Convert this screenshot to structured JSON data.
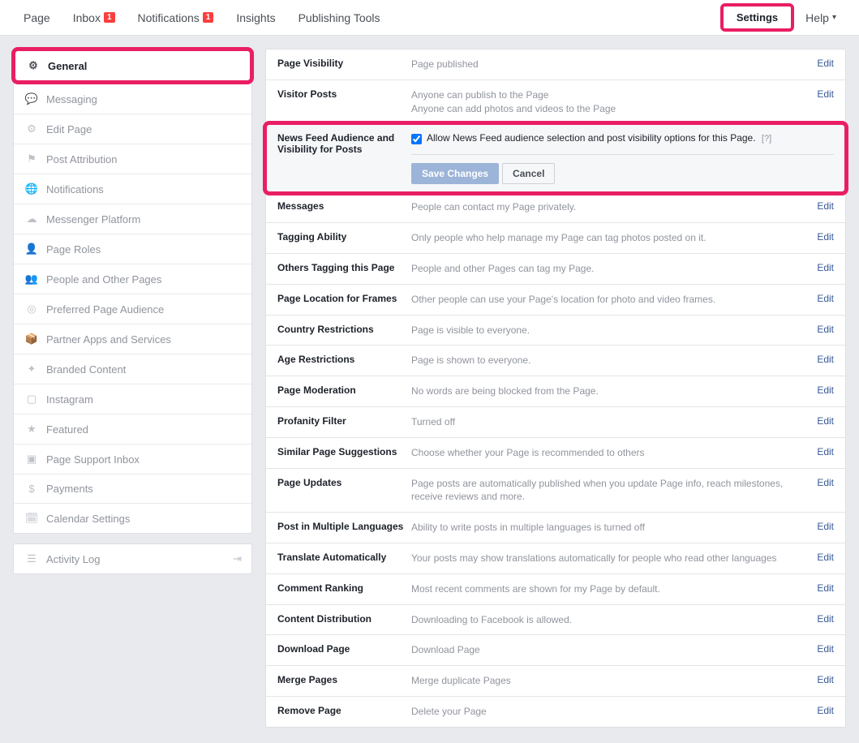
{
  "topnav": {
    "items": [
      {
        "label": "Page",
        "badge": ""
      },
      {
        "label": "Inbox",
        "badge": "1"
      },
      {
        "label": "Notifications",
        "badge": "1"
      },
      {
        "label": "Insights",
        "badge": ""
      },
      {
        "label": "Publishing Tools",
        "badge": ""
      }
    ],
    "settings_label": "Settings",
    "help_label": "Help"
  },
  "sidebar": {
    "items": [
      {
        "icon": "⚙",
        "label": "General",
        "active": true
      },
      {
        "icon": "💬",
        "label": "Messaging"
      },
      {
        "icon": "⚙",
        "label": "Edit Page"
      },
      {
        "icon": "⚑",
        "label": "Post Attribution"
      },
      {
        "icon": "🌐",
        "label": "Notifications"
      },
      {
        "icon": "☁",
        "label": "Messenger Platform"
      },
      {
        "icon": "👤",
        "label": "Page Roles"
      },
      {
        "icon": "👥",
        "label": "People and Other Pages"
      },
      {
        "icon": "◎",
        "label": "Preferred Page Audience"
      },
      {
        "icon": "📦",
        "label": "Partner Apps and Services"
      },
      {
        "icon": "✦",
        "label": "Branded Content"
      },
      {
        "icon": "▢",
        "label": "Instagram"
      },
      {
        "icon": "★",
        "label": "Featured"
      },
      {
        "icon": "▣",
        "label": "Page Support Inbox"
      },
      {
        "icon": "$",
        "label": "Payments"
      },
      {
        "icon": "🗓",
        "label": "Calendar Settings"
      }
    ],
    "activity_log": "Activity Log"
  },
  "settings": [
    {
      "label": "Page Visibility",
      "value": "Page published",
      "edit": "Edit"
    },
    {
      "label": "Visitor Posts",
      "value": "Anyone can publish to the Page\nAnyone can add photos and videos to the Page",
      "edit": "Edit"
    }
  ],
  "expanded": {
    "label": "News Feed Audience and Visibility for Posts",
    "checkbox_text": "Allow News Feed audience selection and post visibility options for this Page.",
    "help": "[?]",
    "save": "Save Changes",
    "cancel": "Cancel"
  },
  "settings_after": [
    {
      "label": "Messages",
      "value": "People can contact my Page privately.",
      "edit": "Edit"
    },
    {
      "label": "Tagging Ability",
      "value": "Only people who help manage my Page can tag photos posted on it.",
      "edit": "Edit"
    },
    {
      "label": "Others Tagging this Page",
      "value": "People and other Pages can tag my Page.",
      "edit": "Edit"
    },
    {
      "label": "Page Location for Frames",
      "value": "Other people can use your Page's location for photo and video frames.",
      "edit": "Edit"
    },
    {
      "label": "Country Restrictions",
      "value": "Page is visible to everyone.",
      "edit": "Edit"
    },
    {
      "label": "Age Restrictions",
      "value": "Page is shown to everyone.",
      "edit": "Edit"
    },
    {
      "label": "Page Moderation",
      "value": "No words are being blocked from the Page.",
      "edit": "Edit"
    },
    {
      "label": "Profanity Filter",
      "value": "Turned off",
      "edit": "Edit"
    },
    {
      "label": "Similar Page Suggestions",
      "value": "Choose whether your Page is recommended to others",
      "edit": "Edit"
    },
    {
      "label": "Page Updates",
      "value": "Page posts are automatically published when you update Page info, reach milestones, receive reviews and more.",
      "edit": "Edit"
    },
    {
      "label": "Post in Multiple Languages",
      "value": "Ability to write posts in multiple languages is turned off",
      "edit": "Edit"
    },
    {
      "label": "Translate Automatically",
      "value": "Your posts may show translations automatically for people who read other languages",
      "edit": "Edit"
    },
    {
      "label": "Comment Ranking",
      "value": "Most recent comments are shown for my Page by default.",
      "edit": "Edit"
    },
    {
      "label": "Content Distribution",
      "value": "Downloading to Facebook is allowed.",
      "edit": "Edit"
    },
    {
      "label": "Download Page",
      "value": "Download Page",
      "edit": "Edit"
    },
    {
      "label": "Merge Pages",
      "value": "Merge duplicate Pages",
      "edit": "Edit"
    },
    {
      "label": "Remove Page",
      "value": "Delete your Page",
      "edit": "Edit"
    }
  ]
}
